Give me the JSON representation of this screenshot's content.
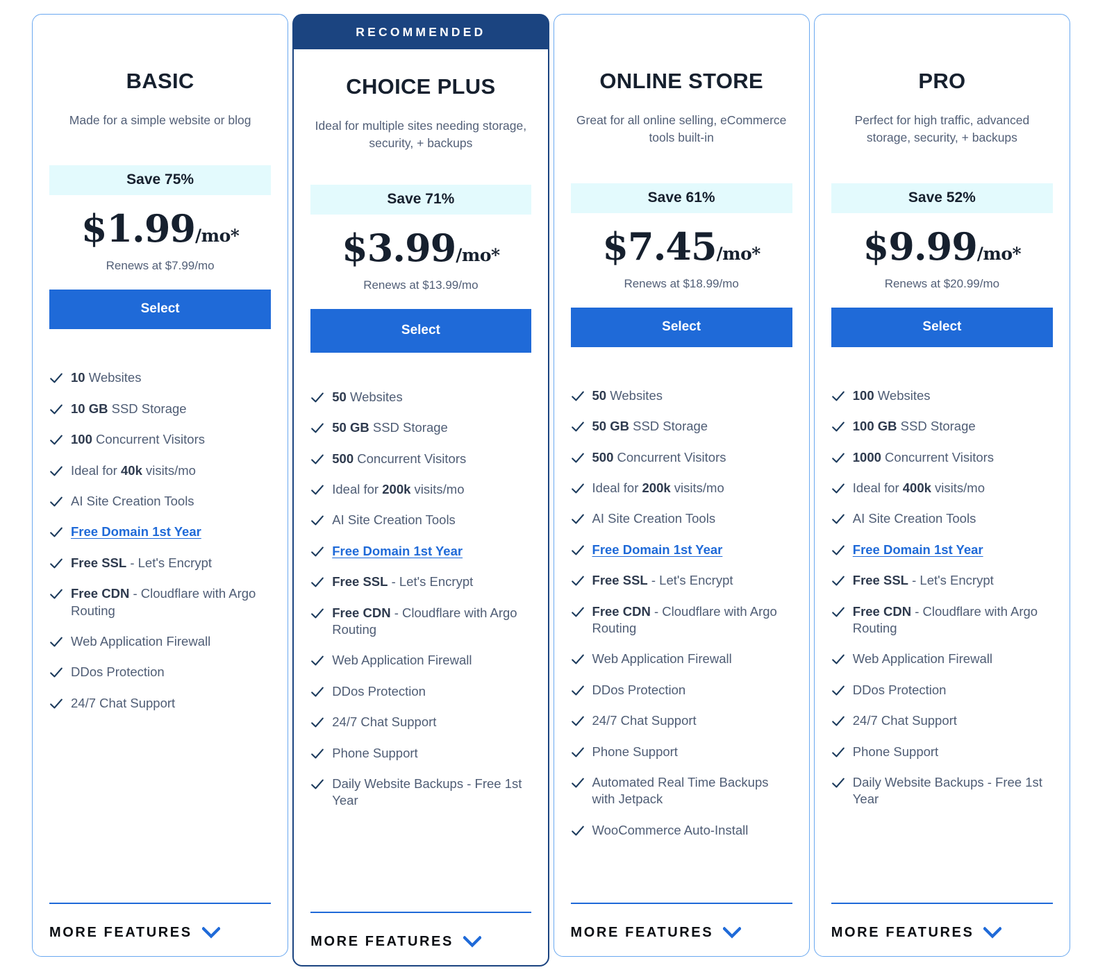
{
  "icons": {
    "check": "check-icon",
    "chevron_down": "chevron-down-icon"
  },
  "colors": {
    "accent_blue": "#1f6ad8",
    "recommended_navy": "#1b4480",
    "save_badge_bg": "#e3fafd",
    "card_border": "#6aa8f0",
    "title_text": "#16202e",
    "body_text": "#4f5d75"
  },
  "more_features_label": "MORE FEATURES",
  "plans": [
    {
      "id": "basic",
      "recommended": false,
      "ribbon": "",
      "title": "BASIC",
      "description": "Made for a simple website or blog",
      "save": "Save 75%",
      "price_amount": "$1.99",
      "price_period": "/mo*",
      "renews": "Renews at $7.99/mo",
      "cta": "Select",
      "features": [
        {
          "bold": "10",
          "text": " Websites"
        },
        {
          "bold": "10 GB",
          "text": " SSD Storage"
        },
        {
          "bold": "100",
          "text": " Concurrent Visitors"
        },
        {
          "pre": "Ideal for ",
          "bold": "40k",
          "text": " visits/mo"
        },
        {
          "text": "AI Site Creation Tools"
        },
        {
          "link": "Free Domain 1st Year"
        },
        {
          "bold": "Free SSL",
          "text": " - Let's Encrypt"
        },
        {
          "bold": "Free CDN",
          "text": " - Cloudflare with Argo Routing"
        },
        {
          "text": "Web Application Firewall"
        },
        {
          "text": "DDos Protection"
        },
        {
          "text": "24/7 Chat Support"
        }
      ]
    },
    {
      "id": "choice-plus",
      "recommended": true,
      "ribbon": "RECOMMENDED",
      "title": "CHOICE PLUS",
      "description": "Ideal for multiple sites needing storage, security, + backups",
      "save": "Save 71%",
      "price_amount": "$3.99",
      "price_period": "/mo*",
      "renews": "Renews at $13.99/mo",
      "cta": "Select",
      "features": [
        {
          "bold": "50",
          "text": " Websites"
        },
        {
          "bold": "50 GB",
          "text": " SSD Storage"
        },
        {
          "bold": "500",
          "text": " Concurrent Visitors"
        },
        {
          "pre": "Ideal for ",
          "bold": "200k",
          "text": " visits/mo"
        },
        {
          "text": "AI Site Creation Tools"
        },
        {
          "link": "Free Domain 1st Year"
        },
        {
          "bold": "Free SSL",
          "text": " - Let's Encrypt"
        },
        {
          "bold": "Free CDN",
          "text": " - Cloudflare with Argo Routing"
        },
        {
          "text": "Web Application Firewall"
        },
        {
          "text": "DDos Protection"
        },
        {
          "text": "24/7 Chat Support"
        },
        {
          "text": "Phone Support"
        },
        {
          "text": "Daily Website Backups - Free 1st Year"
        }
      ]
    },
    {
      "id": "online-store",
      "recommended": false,
      "ribbon": "",
      "title": "ONLINE STORE",
      "description": "Great for all online selling, eCommerce tools built-in",
      "save": "Save 61%",
      "price_amount": "$7.45",
      "price_period": "/mo*",
      "renews": "Renews at $18.99/mo",
      "cta": "Select",
      "features": [
        {
          "bold": "50",
          "text": " Websites"
        },
        {
          "bold": "50 GB",
          "text": " SSD Storage"
        },
        {
          "bold": "500",
          "text": " Concurrent Visitors"
        },
        {
          "pre": "Ideal for ",
          "bold": "200k",
          "text": " visits/mo"
        },
        {
          "text": "AI Site Creation Tools"
        },
        {
          "link": "Free Domain 1st Year"
        },
        {
          "bold": "Free SSL",
          "text": " - Let's Encrypt"
        },
        {
          "bold": "Free CDN",
          "text": " - Cloudflare with Argo Routing"
        },
        {
          "text": "Web Application Firewall"
        },
        {
          "text": "DDos Protection"
        },
        {
          "text": "24/7 Chat Support"
        },
        {
          "text": "Phone Support"
        },
        {
          "text": "Automated Real Time Backups with Jetpack"
        },
        {
          "text": "WooCommerce Auto-Install"
        }
      ]
    },
    {
      "id": "pro",
      "recommended": false,
      "ribbon": "",
      "title": "PRO",
      "description": "Perfect for high traffic, advanced storage, security, + backups",
      "save": "Save 52%",
      "price_amount": "$9.99",
      "price_period": "/mo*",
      "renews": "Renews at $20.99/mo",
      "cta": "Select",
      "features": [
        {
          "bold": "100",
          "text": " Websites"
        },
        {
          "bold": "100 GB",
          "text": " SSD Storage"
        },
        {
          "bold": "1000",
          "text": " Concurrent Visitors"
        },
        {
          "pre": "Ideal for ",
          "bold": "400k",
          "text": " visits/mo"
        },
        {
          "text": "AI Site Creation Tools"
        },
        {
          "link": "Free Domain 1st Year"
        },
        {
          "bold": "Free SSL",
          "text": " - Let's Encrypt"
        },
        {
          "bold": "Free CDN",
          "text": " - Cloudflare with Argo Routing"
        },
        {
          "text": "Web Application Firewall"
        },
        {
          "text": "DDos Protection"
        },
        {
          "text": "24/7 Chat Support"
        },
        {
          "text": "Phone Support"
        },
        {
          "text": "Daily Website Backups - Free 1st Year"
        }
      ]
    }
  ]
}
